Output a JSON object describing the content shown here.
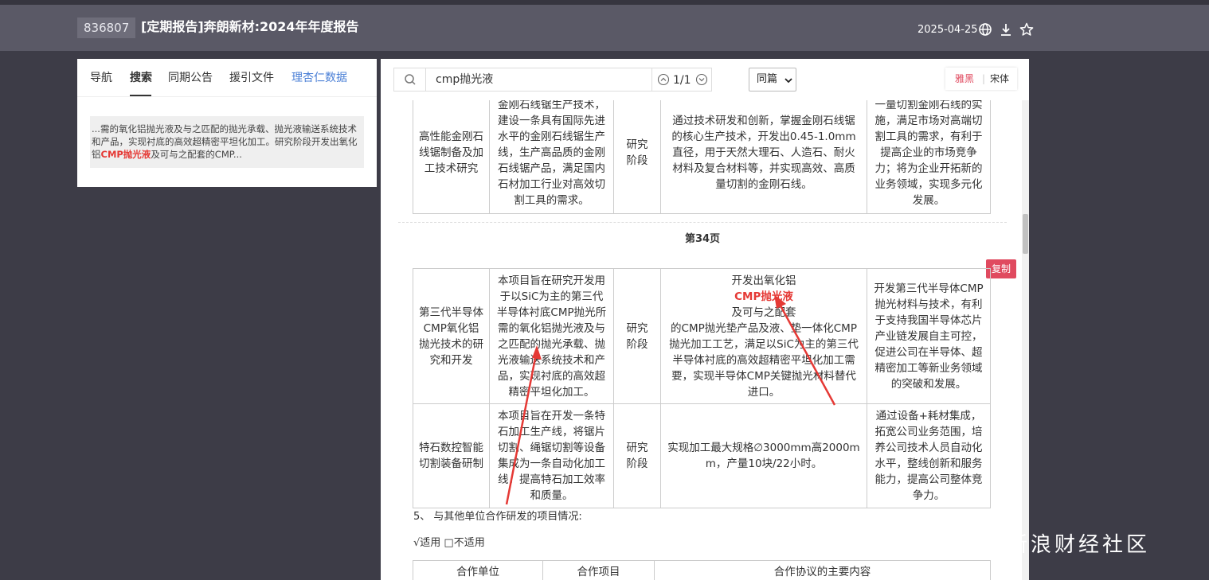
{
  "header": {
    "stock_code": "836807",
    "title": "[定期报告]奔朗新材:2024年年度报告",
    "date": "2025-04-25",
    "icons": [
      "globe-icon",
      "download-icon",
      "star-icon"
    ]
  },
  "left_panel": {
    "tabs": [
      {
        "label": "导航"
      },
      {
        "label": "搜索"
      },
      {
        "label": "同期公告"
      },
      {
        "label": "援引文件"
      },
      {
        "label": "理杏仁数据"
      }
    ],
    "active_tab": "搜索",
    "result": {
      "text_before": "...需的氧化铝抛光液及与之匹配的抛光承载、抛光液输送系统技术和产品，实现衬底的高效超精密平坦化加工。研究阶段开发出氧化铝",
      "highlight": "CMP抛光液",
      "text_after": "及可与之配套的CMP..."
    }
  },
  "toolbar": {
    "search_value": "cmp抛光液",
    "match_count": "1/1",
    "scope_selected": "同篇",
    "font_options": [
      "雅黑",
      "宋体"
    ]
  },
  "document": {
    "row0": {
      "name": "高性能金刚石线锯制备及加工技术研究",
      "purpose": [
        "金刚石线锯生产技术，",
        "建设一条具有国际先进",
        "水平的金刚石线锯生产",
        "线，生产高品质的金刚",
        "石线锯产品，满足国内",
        "石材加工行业对高效切",
        "割工具的需求。"
      ],
      "stage": "研究阶段",
      "goal": [
        "通过技术研发和创新，掌握金刚石线锯",
        "的核心生产技术，开发出0.45-1.0mm",
        "直径，用于天然大理石、人造石、耐火",
        "材料及复合材料等，并实现高效、高质",
        "量切割的金刚石线。"
      ],
      "impact": [
        "一量切割金刚石线的实",
        "施，满足市场对高端切",
        "割工具的需求，有利于",
        "提高企业的市场竞争",
        "力；将为企业开拓新的",
        "业务领域，实现多元化",
        "发展。"
      ]
    },
    "page_label": "第34页",
    "copy_button": "复制",
    "row1": {
      "name": [
        "第三代半导体",
        "CMP氧化铝",
        "抛光技术的研",
        "究和开发"
      ],
      "purpose": [
        "本项目旨在研究开发用",
        "于以SiC为主的第三代",
        "半导体衬底CMP抛光所",
        "需的氧化铝抛光液及与",
        "之匹配的抛光承载、抛",
        "光液输送系统技术和产",
        "品，实现衬底的高效超",
        "精密平坦化加工。"
      ],
      "stage": "研究阶段",
      "goal_before": "开发出氧化铝",
      "goal_highlight": "CMP抛光液",
      "goal_after": "及可与之配套",
      "goal": [
        "的CMP抛光垫产品及液、垫一体化CMP",
        "抛光加工工艺，满足以SiC为主的第三代",
        "半导体衬底的高效超精密平坦化加工需",
        "要，实现半导体CMP关键抛光材料替代",
        "进口。"
      ],
      "impact": [
        "开发第三代半导体CMP",
        "抛光材料与技术，有利",
        "于支持我国半导体芯片",
        "产业链发展自主可控，",
        "促进公司在半导体、超",
        "精密加工等新业务领域",
        "的突破和发展。"
      ]
    },
    "row2": {
      "name": [
        "特石数控智能",
        "切割装备研制"
      ],
      "purpose": [
        "本项目旨在开发一条特",
        "石加工生产线，将锯片",
        "切割、绳锯切割等设备",
        "集成为一条自动化加工",
        "线，提高特石加工效率",
        "和质量。"
      ],
      "stage": "研究阶段",
      "goal": [
        "实现加工最大规格∅3000mm高2000m",
        "m，产量10块/22小时。"
      ],
      "impact": [
        "通过设备+耗材集成，",
        "拓宽公司业务范围，培",
        "养公司技术人员自动化",
        "水平，整线创新和服务",
        "能力，提高公司整体竞",
        "争力。"
      ]
    },
    "section5": "5、 与其他单位合作研发的项目情况:",
    "applicable": "√适用 □不适用",
    "coop_headers": [
      "合作单位",
      "合作项目",
      "合作协议的主要内容"
    ]
  },
  "watermark": {
    "logo": "sina",
    "text": "新浪财经社区"
  }
}
